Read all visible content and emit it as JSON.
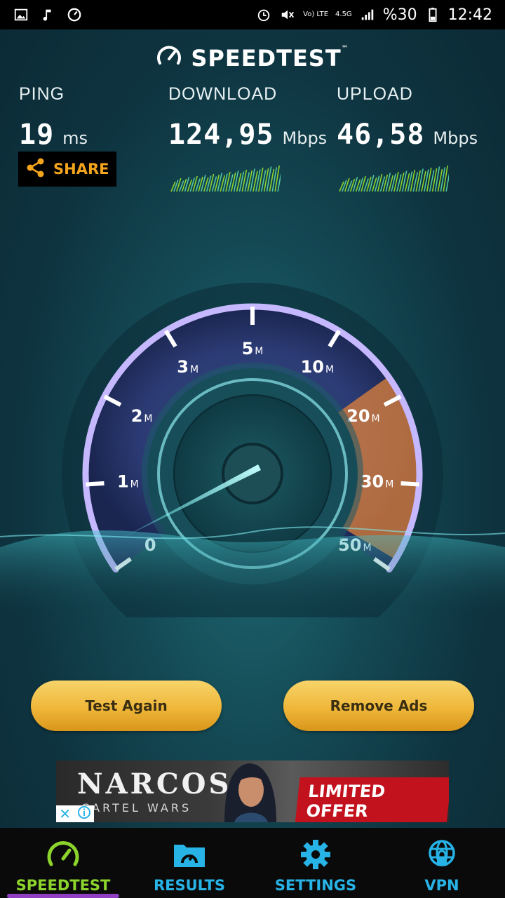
{
  "status_bar": {
    "battery_percent": "%30",
    "time": "12:42",
    "network_top": "Vo) LTE",
    "network_speed": "4.5G"
  },
  "header": {
    "brand": "SPEEDTEST",
    "trademark": "™"
  },
  "ping": {
    "label": "PING",
    "value": "19",
    "unit": "ms"
  },
  "download": {
    "label": "DOWNLOAD",
    "value": "124,95",
    "unit": "Mbps"
  },
  "upload": {
    "label": "UPLOAD",
    "value": "46,58",
    "unit": "Mbps"
  },
  "share": {
    "label": "SHARE"
  },
  "gauge": {
    "ticks": [
      {
        "value": "0",
        "unit": ""
      },
      {
        "value": "1",
        "unit": "M"
      },
      {
        "value": "2",
        "unit": "M"
      },
      {
        "value": "3",
        "unit": "M"
      },
      {
        "value": "5",
        "unit": "M"
      },
      {
        "value": "10",
        "unit": "M"
      },
      {
        "value": "20",
        "unit": "M"
      },
      {
        "value": "30",
        "unit": "M"
      },
      {
        "value": "50",
        "unit": "M"
      }
    ],
    "accent_color": "#e0823a",
    "ring_color": "#c6b8ff"
  },
  "buttons": {
    "test_again": "Test Again",
    "remove_ads": "Remove Ads"
  },
  "ad": {
    "title": "NARCOS",
    "subtitle": "CARTEL WARS",
    "offer": "LIMITED OFFER"
  },
  "nav": [
    {
      "label": "SPEEDTEST",
      "icon": "gauge-icon",
      "active": true
    },
    {
      "label": "RESULTS",
      "icon": "folder-gauge-icon",
      "active": false
    },
    {
      "label": "SETTINGS",
      "icon": "gear-icon",
      "active": false
    },
    {
      "label": "VPN",
      "icon": "globe-lock-icon",
      "active": false
    }
  ]
}
